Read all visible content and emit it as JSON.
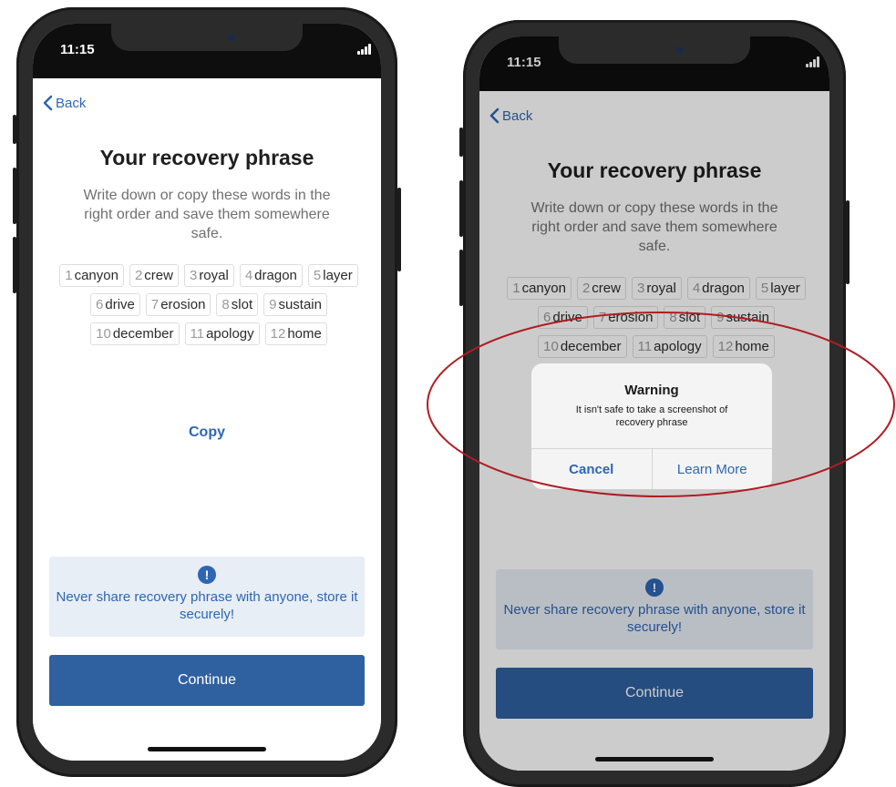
{
  "status_time": "11:15",
  "back_label": "Back",
  "title": "Your recovery phrase",
  "subtitle": "Write down or copy these words in the right order and save them somewhere safe.",
  "words": [
    {
      "num": "1",
      "word": "canyon"
    },
    {
      "num": "2",
      "word": "crew"
    },
    {
      "num": "3",
      "word": "royal"
    },
    {
      "num": "4",
      "word": "dragon"
    },
    {
      "num": "5",
      "word": "layer"
    },
    {
      "num": "6",
      "word": "drive"
    },
    {
      "num": "7",
      "word": "erosion"
    },
    {
      "num": "8",
      "word": "slot"
    },
    {
      "num": "9",
      "word": "sustain"
    },
    {
      "num": "10",
      "word": "december"
    },
    {
      "num": "11",
      "word": "apology"
    },
    {
      "num": "12",
      "word": "home"
    }
  ],
  "copy_label": "Copy",
  "info_icon": "!",
  "info_text": "Never share recovery phrase with anyone, store it securely!",
  "continue_label": "Continue",
  "alert": {
    "title": "Warning",
    "message": "It isn't safe to take a screenshot of recovery phrase",
    "cancel": "Cancel",
    "learn_more": "Learn More"
  },
  "icons": {
    "back": "chevron-left-icon",
    "info": "exclamation-circle-icon",
    "signal": "cellular-signal-icon",
    "wifi": "wifi-icon",
    "battery": "battery-icon"
  },
  "colors": {
    "accent": "#2e66b3",
    "button": "#2f61a0",
    "info_bg": "#e8eef6",
    "highlight": "#b01c22"
  }
}
